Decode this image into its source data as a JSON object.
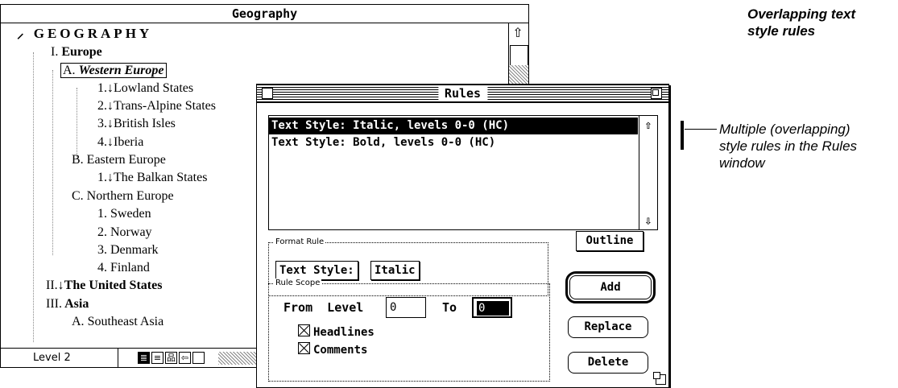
{
  "geography_window": {
    "title": "Geography",
    "outline": [
      {
        "marker": "",
        "text": "GEOGRAPHY",
        "style": "root",
        "indent": 0
      },
      {
        "marker": "I.",
        "text": "Europe",
        "style": "bold",
        "indent": 1
      },
      {
        "marker": "A.",
        "text": "Western Europe",
        "style": "bold-italic-selected",
        "indent": 2
      },
      {
        "marker": "1.↓",
        "text": "Lowland States",
        "style": "plain",
        "indent": 3
      },
      {
        "marker": "2.↓",
        "text": "Trans-Alpine States",
        "style": "plain",
        "indent": 3
      },
      {
        "marker": "3.↓",
        "text": "British Isles",
        "style": "plain",
        "indent": 3
      },
      {
        "marker": "4.↓",
        "text": "Iberia",
        "style": "plain",
        "indent": 3
      },
      {
        "marker": "B.",
        "text": "Eastern Europe",
        "style": "plain",
        "indent": 2
      },
      {
        "marker": "1.↓",
        "text": "The Balkan States",
        "style": "plain",
        "indent": 3
      },
      {
        "marker": "C.",
        "text": "Northern Europe",
        "style": "plain",
        "indent": 2
      },
      {
        "marker": "1.",
        "text": "Sweden",
        "style": "plain",
        "indent": 3
      },
      {
        "marker": "2.",
        "text": "Norway",
        "style": "plain",
        "indent": 3
      },
      {
        "marker": "3.",
        "text": "Denmark",
        "style": "plain",
        "indent": 3
      },
      {
        "marker": "4.",
        "text": "Finland",
        "style": "plain",
        "indent": 3
      },
      {
        "marker": "II.↓",
        "text": "The United States",
        "style": "bold",
        "indent": 1
      },
      {
        "marker": "III.",
        "text": "Asia",
        "style": "bold",
        "indent": 1
      },
      {
        "marker": "A.",
        "text": "Southeast Asia",
        "style": "plain",
        "indent": 2
      }
    ],
    "status_level": "Level 2",
    "scroll_up_icon": "up-arrow-icon"
  },
  "rules_window": {
    "title": "Rules",
    "rules": [
      {
        "text": "Text Style: Italic, levels 0-0 (HC)",
        "selected": true
      },
      {
        "text": "Text Style: Bold, levels 0-0 (HC)",
        "selected": false
      }
    ],
    "format_rule": {
      "group_label": "Format Rule",
      "property": "Text Style:",
      "value": "Italic"
    },
    "outline_button": "Outline",
    "rule_scope": {
      "group_label": "Rule Scope",
      "from_label": "From  Level",
      "from_value": "0",
      "to_label": "To",
      "to_value": "0",
      "headlines_label": "Headlines",
      "headlines_checked": true,
      "comments_label": "Comments",
      "comments_checked": true
    },
    "buttons": {
      "add": "Add",
      "replace": "Replace",
      "delete": "Delete"
    }
  },
  "annotations": {
    "title_line1": "Overlapping text",
    "title_line2": "style rules",
    "callout_line1": "Multiple (overlapping)",
    "callout_line2": "style rules in the Rules",
    "callout_line3": "window"
  }
}
